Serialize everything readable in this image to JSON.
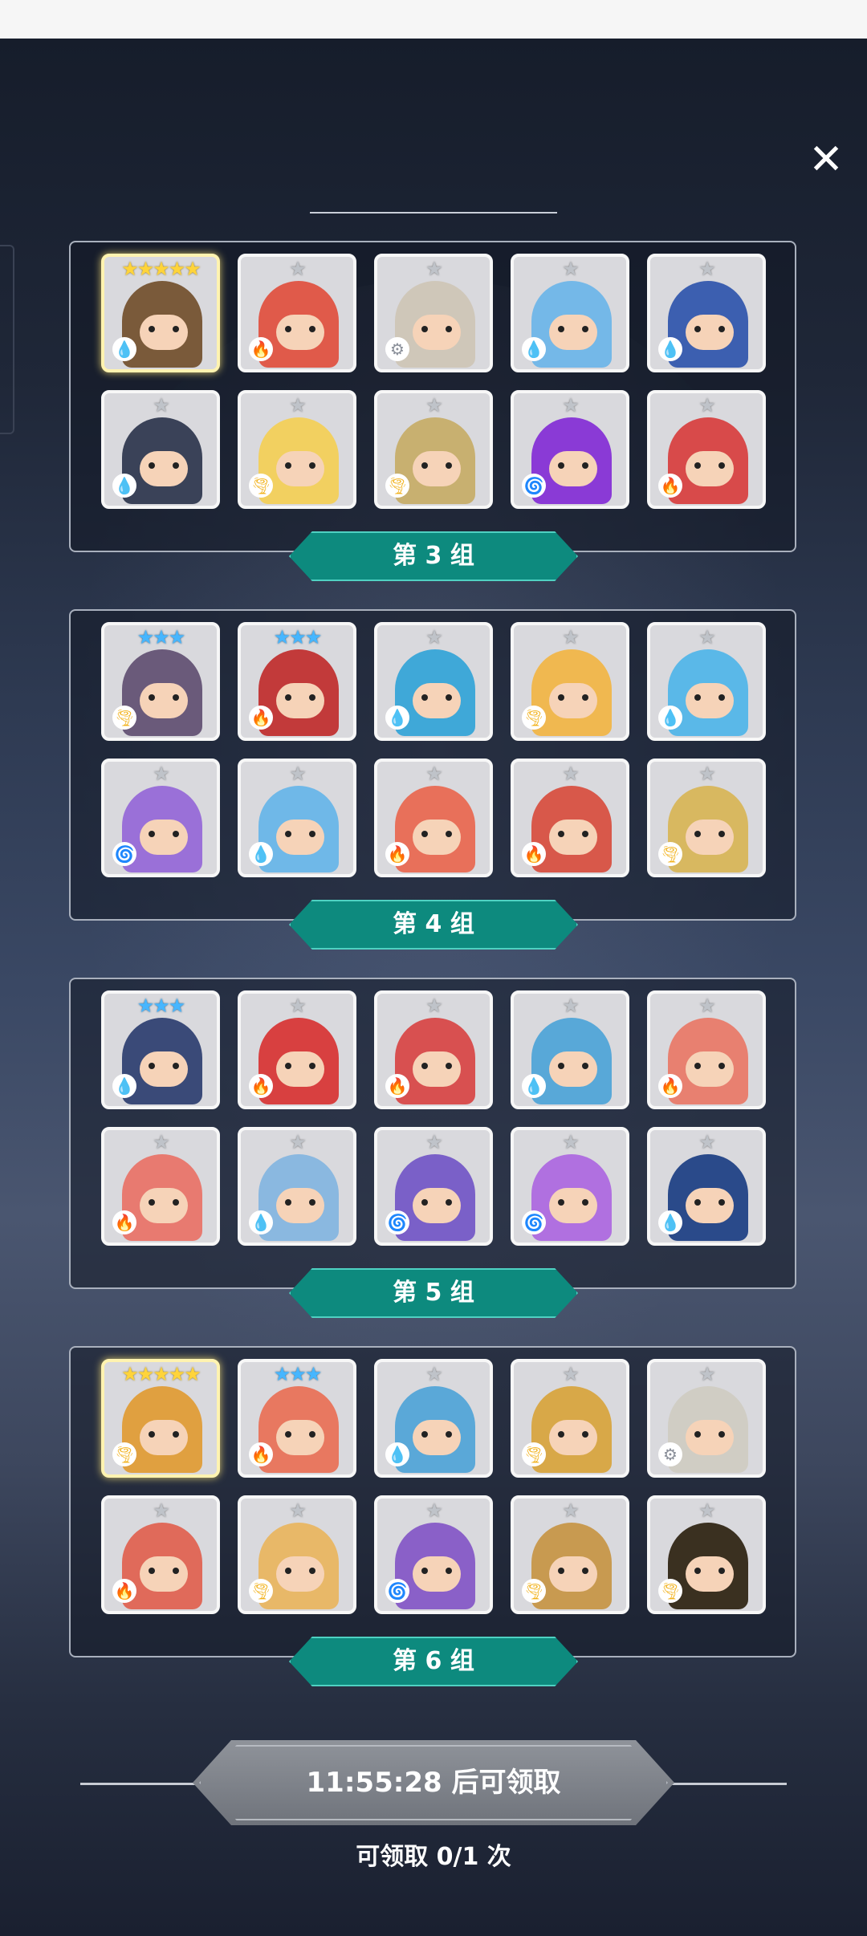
{
  "close_label": "✕",
  "claim": {
    "button_text": "11:55:28 后可领取",
    "count_text": "可领取 0/1 次"
  },
  "groups": [
    {
      "label": "第 3 组",
      "heroes": [
        {
          "stars": "★★★★★",
          "rank": "s5",
          "element": "water",
          "color": "#7a5a3a"
        },
        {
          "stars": "★",
          "rank": "s1",
          "element": "fire",
          "color": "#e05a4a"
        },
        {
          "stars": "★",
          "rank": "s1",
          "element": "light",
          "color": "#cfc7b9"
        },
        {
          "stars": "★",
          "rank": "s1",
          "element": "water",
          "color": "#74b8e8"
        },
        {
          "stars": "★",
          "rank": "s1",
          "element": "water",
          "color": "#3c5fb0"
        },
        {
          "stars": "★",
          "rank": "s1",
          "element": "water",
          "color": "#3a4258"
        },
        {
          "stars": "★",
          "rank": "s1",
          "element": "wind",
          "color": "#f2d060"
        },
        {
          "stars": "★",
          "rank": "s1",
          "element": "wind",
          "color": "#c8b070"
        },
        {
          "stars": "★",
          "rank": "s1",
          "element": "dark",
          "color": "#8a3ad6"
        },
        {
          "stars": "★",
          "rank": "s1",
          "element": "fire",
          "color": "#d84a4a"
        }
      ]
    },
    {
      "label": "第 4 组",
      "heroes": [
        {
          "stars": "★★★",
          "rank": "s3",
          "element": "wind",
          "color": "#6a5a7a"
        },
        {
          "stars": "★★★",
          "rank": "s3",
          "element": "fire",
          "color": "#c23a3a"
        },
        {
          "stars": "★",
          "rank": "s1",
          "element": "water",
          "color": "#3fa8d8"
        },
        {
          "stars": "★",
          "rank": "s1",
          "element": "wind",
          "color": "#f0b850"
        },
        {
          "stars": "★",
          "rank": "s1",
          "element": "water",
          "color": "#5ab8e8"
        },
        {
          "stars": "★",
          "rank": "s1",
          "element": "dark",
          "color": "#9a70d8"
        },
        {
          "stars": "★",
          "rank": "s1",
          "element": "water",
          "color": "#6fb8e8"
        },
        {
          "stars": "★",
          "rank": "s1",
          "element": "fire",
          "color": "#e8705a"
        },
        {
          "stars": "★",
          "rank": "s1",
          "element": "fire",
          "color": "#d8584a"
        },
        {
          "stars": "★",
          "rank": "s1",
          "element": "wind",
          "color": "#d8b860"
        }
      ]
    },
    {
      "label": "第 5 组",
      "heroes": [
        {
          "stars": "★★★",
          "rank": "s3",
          "element": "water",
          "color": "#3a4a78"
        },
        {
          "stars": "★",
          "rank": "s1",
          "element": "fire",
          "color": "#d84040"
        },
        {
          "stars": "★",
          "rank": "s1",
          "element": "fire",
          "color": "#d85050"
        },
        {
          "stars": "★",
          "rank": "s1",
          "element": "water",
          "color": "#58a8d8"
        },
        {
          "stars": "★",
          "rank": "s1",
          "element": "fire",
          "color": "#e88070"
        },
        {
          "stars": "★",
          "rank": "s1",
          "element": "fire",
          "color": "#e87a70"
        },
        {
          "stars": "★",
          "rank": "s1",
          "element": "water",
          "color": "#8ab8e0"
        },
        {
          "stars": "★",
          "rank": "s1",
          "element": "dark",
          "color": "#7a60c8"
        },
        {
          "stars": "★",
          "rank": "s1",
          "element": "dark",
          "color": "#b070e0"
        },
        {
          "stars": "★",
          "rank": "s1",
          "element": "water",
          "color": "#2a4a8a"
        }
      ]
    },
    {
      "label": "第 6 组",
      "heroes": [
        {
          "stars": "★★★★★",
          "rank": "s5",
          "element": "wind",
          "color": "#e0a040"
        },
        {
          "stars": "★★★",
          "rank": "s3",
          "element": "fire",
          "color": "#e87860"
        },
        {
          "stars": "★",
          "rank": "s1",
          "element": "water",
          "color": "#5aa8d8"
        },
        {
          "stars": "★",
          "rank": "s1",
          "element": "wind",
          "color": "#d8a848"
        },
        {
          "stars": "★",
          "rank": "s1",
          "element": "light",
          "color": "#d0cdc4"
        },
        {
          "stars": "★",
          "rank": "s1",
          "element": "fire",
          "color": "#e06a5a"
        },
        {
          "stars": "★",
          "rank": "s1",
          "element": "wind",
          "color": "#e8b868"
        },
        {
          "stars": "★",
          "rank": "s1",
          "element": "dark",
          "color": "#8a60c8"
        },
        {
          "stars": "★",
          "rank": "s1",
          "element": "wind",
          "color": "#c89a50"
        },
        {
          "stars": "★",
          "rank": "s1",
          "element": "wind",
          "color": "#3a3020"
        }
      ]
    }
  ],
  "element_icons": {
    "water": "💧",
    "fire": "🔥",
    "wind": "🌪",
    "light": "⚙",
    "dark": "🌀"
  }
}
